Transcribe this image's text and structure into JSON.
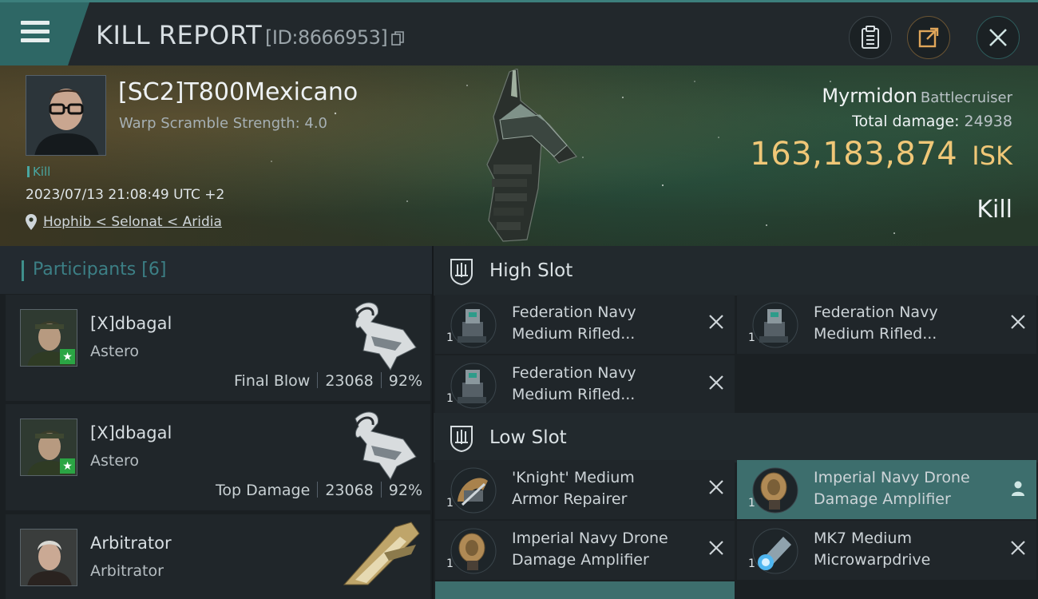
{
  "header": {
    "title": "KILL REPORT",
    "report_id": "[ID:8666953]"
  },
  "victim": {
    "name": "[SC2]T800Mexicano",
    "warp_scramble": "Warp Scramble Strength: 4.0",
    "kill_tag": "Kill",
    "datetime": "2023/07/13 21:08:49 UTC +2",
    "location": "Hophib < Selonat < Aridia"
  },
  "ship": {
    "name": "Myrmidon",
    "class": "Battlecruiser",
    "total_damage_label": "Total damage:",
    "total_damage": "24938",
    "isk_value": "163,183,874",
    "isk_unit": "ISK",
    "result": "Kill"
  },
  "participants": {
    "title": "Participants",
    "count": "[6]",
    "rows": [
      {
        "name": "[X]dbagal",
        "ship": "Astero",
        "role": "Final Blow",
        "damage": "23068",
        "percent": "92%"
      },
      {
        "name": "[X]dbagal",
        "ship": "Astero",
        "role": "Top Damage",
        "damage": "23068",
        "percent": "92%"
      },
      {
        "name": "Arbitrator",
        "ship": "Arbitrator"
      }
    ]
  },
  "slots": {
    "high": {
      "title": "High Slot",
      "items": [
        {
          "qty": "1",
          "name_line1": "Federation Navy",
          "name_line2": "Medium Rifled..."
        },
        {
          "qty": "1",
          "name_line1": "Federation Navy",
          "name_line2": "Medium Rifled..."
        },
        {
          "qty": "1",
          "name_line1": "Federation Navy",
          "name_line2": "Medium Rifled..."
        }
      ]
    },
    "low": {
      "title": "Low Slot",
      "items": [
        {
          "qty": "1",
          "name_line1": "'Knight' Medium",
          "name_line2": "Armor Repairer"
        },
        {
          "qty": "1",
          "name_line1": "Imperial Navy Drone",
          "name_line2": "Damage Amplifier"
        },
        {
          "qty": "1",
          "name_line1": "Imperial Navy Drone",
          "name_line2": "Damage Amplifier"
        },
        {
          "qty": "1",
          "name_line1": "MK7 Medium",
          "name_line2": "Microwarpdrive"
        }
      ]
    }
  },
  "colors": {
    "accent_teal": "#3c7f7c",
    "isk_gold": "#f0c777",
    "highlight_row": "#3d6e6d"
  }
}
